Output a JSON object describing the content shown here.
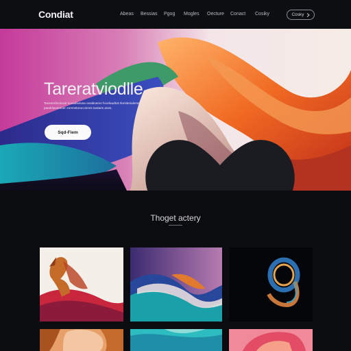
{
  "brand": {
    "name": "Condiat"
  },
  "nav": {
    "links": [
      "Abeas",
      "Bessias",
      "Pgog",
      "Mogles",
      "Oecture",
      "Conact",
      "Cosiky"
    ],
    "button_label": "Cosky",
    "button_icon": "chevron-right-icon"
  },
  "hero": {
    "title": "Tareratviodlle",
    "subtitle": "Tanesrefreciocie nuvadsetosa oeatitoeme hcorlaudtos tlorsiterialerse paedritacsoruer eorenstoruccionns taotaes anes.",
    "cta_label": "Sqd-Fiem",
    "cta_icon": "heart-icon"
  },
  "gallery": {
    "title": "Thoget actery",
    "tiles": [
      {
        "name": "gallery-tile-horse"
      },
      {
        "name": "gallery-tile-waves"
      },
      {
        "name": "gallery-tile-swirl"
      },
      {
        "name": "gallery-tile-portrait"
      },
      {
        "name": "gallery-tile-teal-silk"
      },
      {
        "name": "gallery-tile-coral"
      }
    ]
  },
  "colors": {
    "background": "#0b0c10",
    "accent_magenta": "#d0308f",
    "accent_orange": "#f07a2a",
    "accent_teal": "#1fa6b4",
    "accent_blue": "#2a3fa5"
  }
}
